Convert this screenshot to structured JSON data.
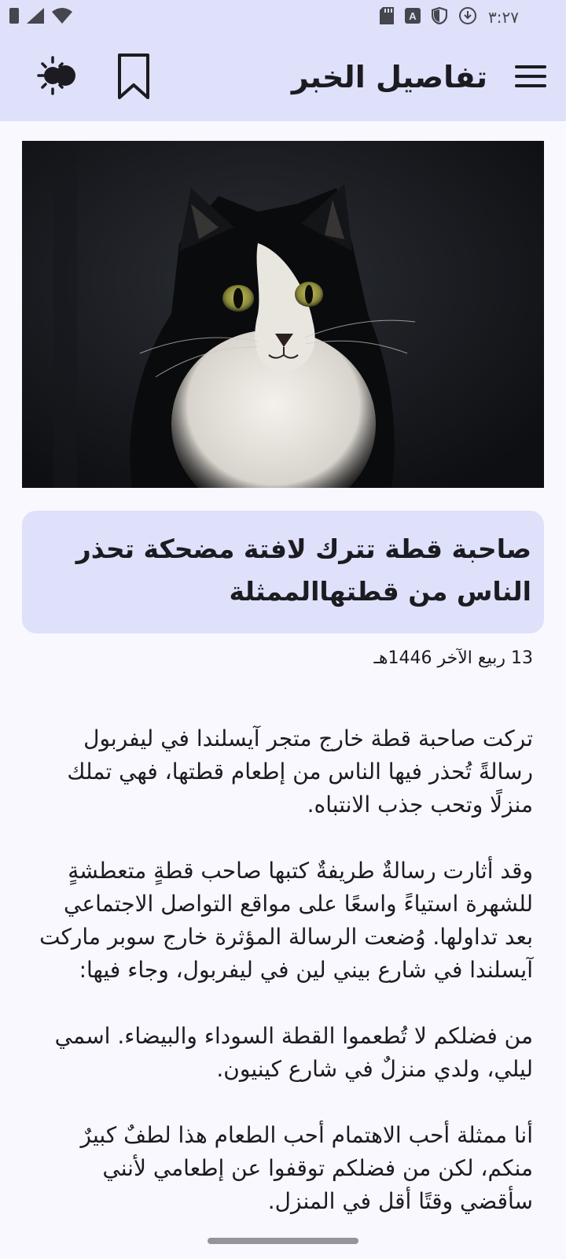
{
  "status_bar": {
    "time": "٣:٢٧",
    "icons": [
      "sim-icon",
      "signal-icon",
      "wifi-icon",
      "sd-card-icon",
      "accessibility-icon",
      "shield-icon",
      "download-icon"
    ]
  },
  "app_bar": {
    "title": "تفاصيل الخبر",
    "menu_icon": "menu-icon",
    "bookmark_icon": "bookmark-icon",
    "theme_icon": "theme-toggle-icon"
  },
  "article": {
    "image_subject": "cat-photo",
    "headline": "صاحبة قطة تترك لافتة مضحكة تحذر الناس من قطتهاالممثلة",
    "date": "13 ربيع الآخر 1446هـ",
    "paragraphs": [
      "تركت صاحبة قطة خارج متجر آيسلندا في ليفربول رسالةً تُحذر فيها الناس من إطعام قطتها، فهي تملك منزلًا وتحب جذب الانتباه.",
      "وقد أثارت رسالةٌ طريفةٌ كتبها صاحب قطةٍ متعطشةٍ للشهرة استياءً واسعًا على مواقع التواصل الاجتماعي بعد تداولها. وُضعت الرسالة المؤثرة خارج سوبر ماركت آيسلندا في شارع بيني لين في ليفربول، وجاء فيها:",
      "من فضلكم لا تُطعموا القطة السوداء والبيضاء. اسمي ليلي، ولدي منزلٌ في شارع كينيون.",
      "أنا ممثلة أحب الاهتمام أحب الطعام هذا لطفٌ كبيرٌ منكم، لكن من فضلكم توقفوا عن إطعامي لأنني سأقضي وقتًا أقل في المنزل."
    ]
  },
  "colors": {
    "app_bar_bg": "#DEE1F9",
    "page_bg": "#F8F8FE",
    "text": "#1B1B21"
  }
}
